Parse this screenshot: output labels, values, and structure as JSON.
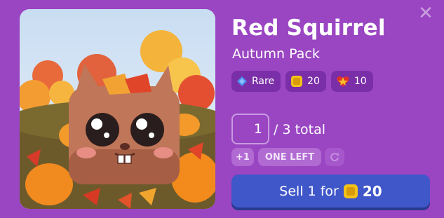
{
  "item": {
    "name": "Red Squirrel",
    "pack": "Autumn Pack"
  },
  "badges": [
    {
      "icon": "diamond-icon",
      "label": "Rare",
      "color": "#4c8ff0"
    },
    {
      "icon": "coin-icon",
      "label": "20",
      "color": "#f2c21a"
    },
    {
      "icon": "star-heart-icon",
      "label": "10",
      "color": "#f05a2a"
    }
  ],
  "quantity": {
    "value": "1",
    "total_label": "/ 3 total"
  },
  "controls": {
    "increment_label": "+1",
    "one_left_label": "ONE LEFT"
  },
  "sell": {
    "label": "Sell 1 for",
    "price": "20"
  },
  "close_label": "✕",
  "colors": {
    "background": "#9a45c2",
    "badge_bg": "#7a2ea8",
    "sell_button": "#3f57c9"
  }
}
